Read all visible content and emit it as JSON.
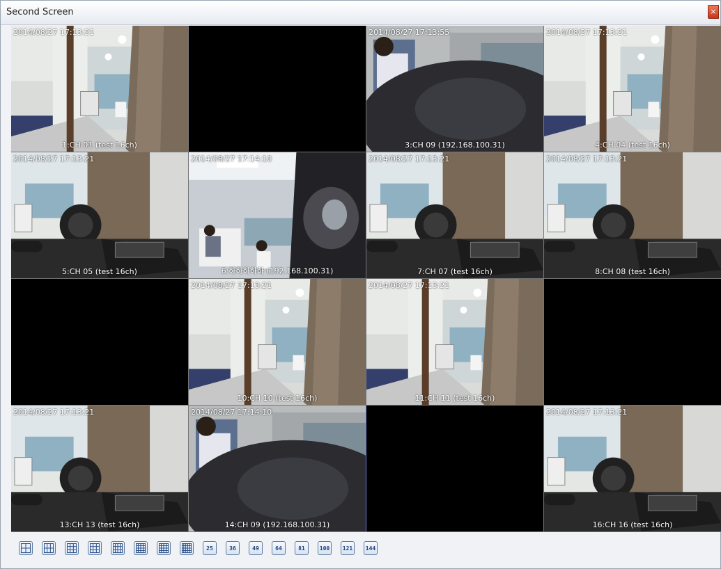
{
  "window": {
    "title": "Second Screen",
    "close_glyph": "×"
  },
  "tiles": [
    {
      "scene": "office",
      "timestamp": "2014/08/27 17:13:21",
      "label": "1:CH 01 (test 16ch)",
      "selected": false
    },
    {
      "scene": "black",
      "timestamp": "",
      "label": "",
      "selected": false
    },
    {
      "scene": "person",
      "timestamp": "2014/08/27 17:13:55",
      "label": "3:CH 09 (192.168.100.31)",
      "selected": false
    },
    {
      "scene": "office",
      "timestamp": "2014/08/27 17:13:21",
      "label": "4:CH 04 (test 16ch)",
      "selected": false
    },
    {
      "scene": "desk",
      "timestamp": "2014/08/27 17:13:21",
      "label": "5:CH 05 (test 16ch)",
      "selected": false
    },
    {
      "scene": "people",
      "timestamp": "2014/08/27 17:14:10",
      "label": "6:하하하하하 (192.168.100.31)",
      "selected": false
    },
    {
      "scene": "desk",
      "timestamp": "2014/08/27 17:13:21",
      "label": "7:CH 07 (test 16ch)",
      "selected": false
    },
    {
      "scene": "desk",
      "timestamp": "2014/08/27 17:13:21",
      "label": "8:CH 08 (test 16ch)",
      "selected": false
    },
    {
      "scene": "black",
      "timestamp": "",
      "label": "",
      "selected": false
    },
    {
      "scene": "office",
      "timestamp": "2014/08/27 17:13:21",
      "label": "10:CH 10 (test 16ch)",
      "selected": false
    },
    {
      "scene": "office",
      "timestamp": "2014/08/27 17:13:21",
      "label": "11:CH 11 (test 16ch)",
      "selected": false
    },
    {
      "scene": "black",
      "timestamp": "",
      "label": "",
      "selected": false
    },
    {
      "scene": "desk",
      "timestamp": "2014/08/27 17:13:21",
      "label": "13:CH 13 (test 16ch)",
      "selected": false
    },
    {
      "scene": "person",
      "timestamp": "2014/08/27 17:14:10",
      "label": "14:CH 09 (192.168.100.31)",
      "selected": true
    },
    {
      "scene": "black",
      "timestamp": "",
      "label": "",
      "selected": false
    },
    {
      "scene": "desk",
      "timestamp": "2014/08/27 17:13:21",
      "label": "16:CH 16 (test 16ch)",
      "selected": false
    }
  ],
  "layout_buttons": [
    {
      "icon": "layout-grid-4-icon",
      "text": ""
    },
    {
      "icon": "layout-grid-6-icon",
      "text": ""
    },
    {
      "icon": "layout-grid-8-icon",
      "text": ""
    },
    {
      "icon": "layout-grid-9-icon",
      "text": ""
    },
    {
      "icon": "layout-grid-10-icon",
      "text": ""
    },
    {
      "icon": "layout-grid-13-icon",
      "text": ""
    },
    {
      "icon": "layout-grid-16-icon",
      "text": ""
    },
    {
      "icon": "layout-grid-20-icon",
      "text": ""
    },
    {
      "icon": "layout-25-icon",
      "text": "25"
    },
    {
      "icon": "layout-36-icon",
      "text": "36"
    },
    {
      "icon": "layout-49-icon",
      "text": "49"
    },
    {
      "icon": "layout-64-icon",
      "text": "64"
    },
    {
      "icon": "layout-81-icon",
      "text": "81"
    },
    {
      "icon": "layout-100-icon",
      "text": "100"
    },
    {
      "icon": "layout-121-icon",
      "text": "121"
    },
    {
      "icon": "layout-144-icon",
      "text": "144"
    }
  ]
}
